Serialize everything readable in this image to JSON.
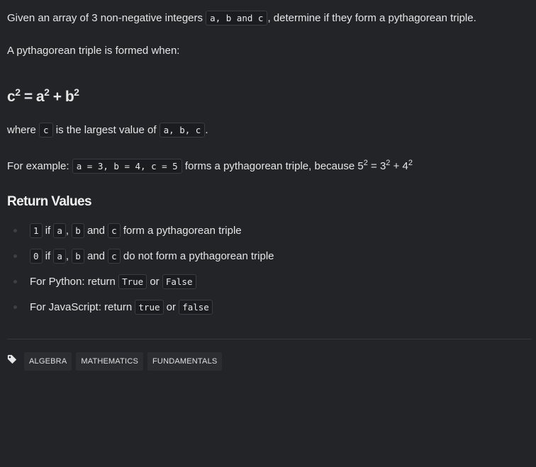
{
  "intro": {
    "text1": "Given an array of 3 non-negative integers",
    "code": "a, b and c",
    "text2": ", determine if they form a pythagorean triple."
  },
  "formed_when": "A pythagorean triple is formed when:",
  "formula": {
    "c": "c",
    "a": "a",
    "b": "b",
    "exp": "2",
    "eq": " = ",
    "plus": " + "
  },
  "where": {
    "text1": "where",
    "code1": "c",
    "text2": "is the largest value of",
    "code2": "a, b, c",
    "text3": "."
  },
  "example": {
    "text1": "For example:",
    "code": "a = 3, b = 4, c = 5",
    "text2": "forms a pythagorean triple, because 5",
    "e1": "2",
    "t3": " = 3",
    "e2": "2",
    "t4": " + 4",
    "e3": "2"
  },
  "return_values": {
    "heading": "Return Values",
    "items": [
      {
        "code1": "1",
        "t1": "if",
        "code2": "a",
        "t2": ",",
        "code3": "b",
        "t3": "and",
        "code4": "c",
        "t4": "form a pythagorean triple"
      },
      {
        "code1": "0",
        "t1": "if",
        "code2": "a",
        "t2": ",",
        "code3": "b",
        "t3": "and",
        "code4": "c",
        "t4": "do not form a pythagorean triple"
      },
      {
        "t1": "For Python: return",
        "code1": "True",
        "t2": "or",
        "code2": "False"
      },
      {
        "t1": "For JavaScript: return",
        "code1": "true",
        "t2": "or",
        "code2": "false"
      }
    ]
  },
  "tags": [
    "ALGEBRA",
    "MATHEMATICS",
    "FUNDAMENTALS"
  ],
  "icons": {
    "tag": "tag-icon",
    "bullet": "bullet-icon"
  },
  "colors": {
    "background": "#222427",
    "text": "#e6e6e6",
    "code_bg": "#1b1c1f",
    "tag_bg": "#2b2d31"
  }
}
